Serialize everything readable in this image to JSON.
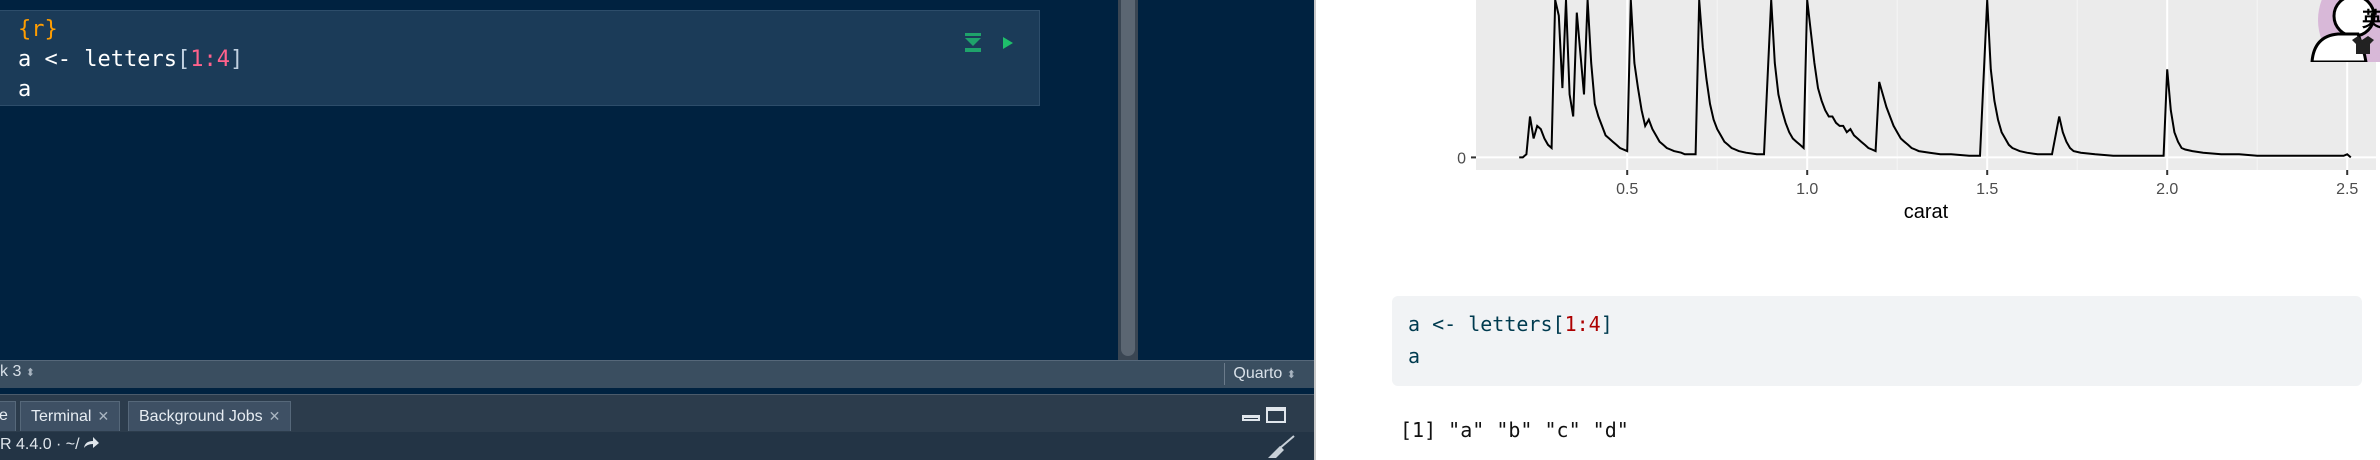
{
  "editor": {
    "chunk_header": "{r}",
    "code_lines": [
      {
        "var": "a",
        "op": " <- ",
        "func": "letters",
        "open": "[",
        "n1": "1",
        "colon": ":",
        "n2": "4",
        "close": "]"
      },
      {
        "text": "a"
      }
    ],
    "status_bar": {
      "chunk_nav": "k 3",
      "doc_type": "Quarto"
    }
  },
  "console": {
    "tabs": [
      {
        "label": "e"
      },
      {
        "label": "Terminal"
      },
      {
        "label": "Background Jobs"
      }
    ],
    "r_version": "R 4.4.0 · ~/"
  },
  "document": {
    "code_lines": [
      {
        "var": "a",
        "op": " <- ",
        "func": "letters",
        "open": "[",
        "n1": "1",
        "colon": ":",
        "n2": "4",
        "close": "]"
      },
      {
        "text": "a"
      }
    ],
    "output": "[1] \"a\" \"b\" \"c\" \"d\""
  },
  "avatar_badge": "英",
  "colors": {
    "editor_bg": "#002240",
    "chunk_bg": "#1b3b58",
    "chunk_header": "#ff9d00",
    "number": "#ff628c",
    "doc_code_bg": "#f1f3f5",
    "doc_number": "#ad0000"
  },
  "chart_data": {
    "type": "line",
    "title": "",
    "xlabel": "carat",
    "ylabel": "",
    "xlim": [
      0.08,
      2.58
    ],
    "x_ticks": [
      "0.5",
      "1.0",
      "1.5",
      "2.0",
      "2.5"
    ],
    "x_tick_values": [
      0.5,
      1.0,
      1.5,
      2.0,
      2.5
    ],
    "y_ticks": [
      "0"
    ],
    "y_tick_values": [
      0
    ],
    "ylim": [
      -8,
      100
    ],
    "series": [
      {
        "values": [
          [
            0.2,
            0
          ],
          [
            0.21,
            0
          ],
          [
            0.22,
            2
          ],
          [
            0.23,
            26
          ],
          [
            0.24,
            12
          ],
          [
            0.25,
            20
          ],
          [
            0.26,
            18
          ],
          [
            0.27,
            12
          ],
          [
            0.28,
            8
          ],
          [
            0.29,
            6
          ],
          [
            0.3,
            100
          ],
          [
            0.31,
            90
          ],
          [
            0.32,
            44
          ],
          [
            0.33,
            100
          ],
          [
            0.34,
            40
          ],
          [
            0.35,
            26
          ],
          [
            0.36,
            92
          ],
          [
            0.38,
            40
          ],
          [
            0.39,
            100
          ],
          [
            0.4,
            60
          ],
          [
            0.41,
            34
          ],
          [
            0.42,
            26
          ],
          [
            0.43,
            20
          ],
          [
            0.44,
            14
          ],
          [
            0.45,
            12
          ],
          [
            0.46,
            10
          ],
          [
            0.47,
            8
          ],
          [
            0.48,
            6
          ],
          [
            0.5,
            4
          ],
          [
            0.51,
            100
          ],
          [
            0.52,
            60
          ],
          [
            0.53,
            44
          ],
          [
            0.54,
            30
          ],
          [
            0.55,
            20
          ],
          [
            0.56,
            24
          ],
          [
            0.57,
            18
          ],
          [
            0.58,
            14
          ],
          [
            0.59,
            10
          ],
          [
            0.6,
            8
          ],
          [
            0.61,
            6
          ],
          [
            0.62,
            5
          ],
          [
            0.63,
            4
          ],
          [
            0.65,
            3
          ],
          [
            0.66,
            2
          ],
          [
            0.68,
            2
          ],
          [
            0.69,
            2
          ],
          [
            0.7,
            100
          ],
          [
            0.71,
            70
          ],
          [
            0.72,
            50
          ],
          [
            0.73,
            34
          ],
          [
            0.74,
            24
          ],
          [
            0.75,
            18
          ],
          [
            0.76,
            14
          ],
          [
            0.77,
            10
          ],
          [
            0.78,
            8
          ],
          [
            0.79,
            6
          ],
          [
            0.8,
            5
          ],
          [
            0.81,
            4
          ],
          [
            0.83,
            3
          ],
          [
            0.86,
            2
          ],
          [
            0.88,
            2
          ],
          [
            0.9,
            100
          ],
          [
            0.91,
            60
          ],
          [
            0.92,
            40
          ],
          [
            0.93,
            30
          ],
          [
            0.94,
            22
          ],
          [
            0.95,
            16
          ],
          [
            0.96,
            12
          ],
          [
            0.97,
            10
          ],
          [
            0.98,
            8
          ],
          [
            0.99,
            6
          ],
          [
            1.0,
            100
          ],
          [
            1.01,
            80
          ],
          [
            1.02,
            60
          ],
          [
            1.03,
            44
          ],
          [
            1.04,
            36
          ],
          [
            1.05,
            30
          ],
          [
            1.06,
            26
          ],
          [
            1.07,
            26
          ],
          [
            1.08,
            22
          ],
          [
            1.09,
            20
          ],
          [
            1.1,
            20
          ],
          [
            1.11,
            16
          ],
          [
            1.12,
            18
          ],
          [
            1.13,
            14
          ],
          [
            1.14,
            12
          ],
          [
            1.15,
            10
          ],
          [
            1.16,
            8
          ],
          [
            1.17,
            6
          ],
          [
            1.18,
            5
          ],
          [
            1.19,
            4
          ],
          [
            1.2,
            48
          ],
          [
            1.21,
            40
          ],
          [
            1.22,
            32
          ],
          [
            1.23,
            26
          ],
          [
            1.24,
            20
          ],
          [
            1.25,
            16
          ],
          [
            1.26,
            12
          ],
          [
            1.27,
            10
          ],
          [
            1.28,
            8
          ],
          [
            1.29,
            6
          ],
          [
            1.3,
            5
          ],
          [
            1.31,
            4
          ],
          [
            1.34,
            3
          ],
          [
            1.37,
            2
          ],
          [
            1.4,
            2
          ],
          [
            1.45,
            1
          ],
          [
            1.48,
            1
          ],
          [
            1.5,
            100
          ],
          [
            1.51,
            56
          ],
          [
            1.52,
            36
          ],
          [
            1.53,
            24
          ],
          [
            1.54,
            16
          ],
          [
            1.55,
            12
          ],
          [
            1.56,
            8
          ],
          [
            1.57,
            6
          ],
          [
            1.58,
            5
          ],
          [
            1.59,
            4
          ],
          [
            1.61,
            3
          ],
          [
            1.64,
            2
          ],
          [
            1.68,
            2
          ],
          [
            1.7,
            26
          ],
          [
            1.71,
            16
          ],
          [
            1.72,
            10
          ],
          [
            1.73,
            6
          ],
          [
            1.74,
            4
          ],
          [
            1.76,
            3
          ],
          [
            1.8,
            2
          ],
          [
            1.85,
            1
          ],
          [
            1.9,
            1
          ],
          [
            1.95,
            1
          ],
          [
            1.99,
            1
          ],
          [
            2.0,
            56
          ],
          [
            2.01,
            30
          ],
          [
            2.02,
            16
          ],
          [
            2.03,
            10
          ],
          [
            2.04,
            6
          ],
          [
            2.05,
            5
          ],
          [
            2.07,
            4
          ],
          [
            2.1,
            3
          ],
          [
            2.15,
            2
          ],
          [
            2.2,
            2
          ],
          [
            2.25,
            1
          ],
          [
            2.3,
            1
          ],
          [
            2.4,
            1
          ],
          [
            2.49,
            1
          ],
          [
            2.5,
            2
          ],
          [
            2.51,
            0
          ]
        ]
      }
    ],
    "grid": true,
    "legend": "none"
  }
}
